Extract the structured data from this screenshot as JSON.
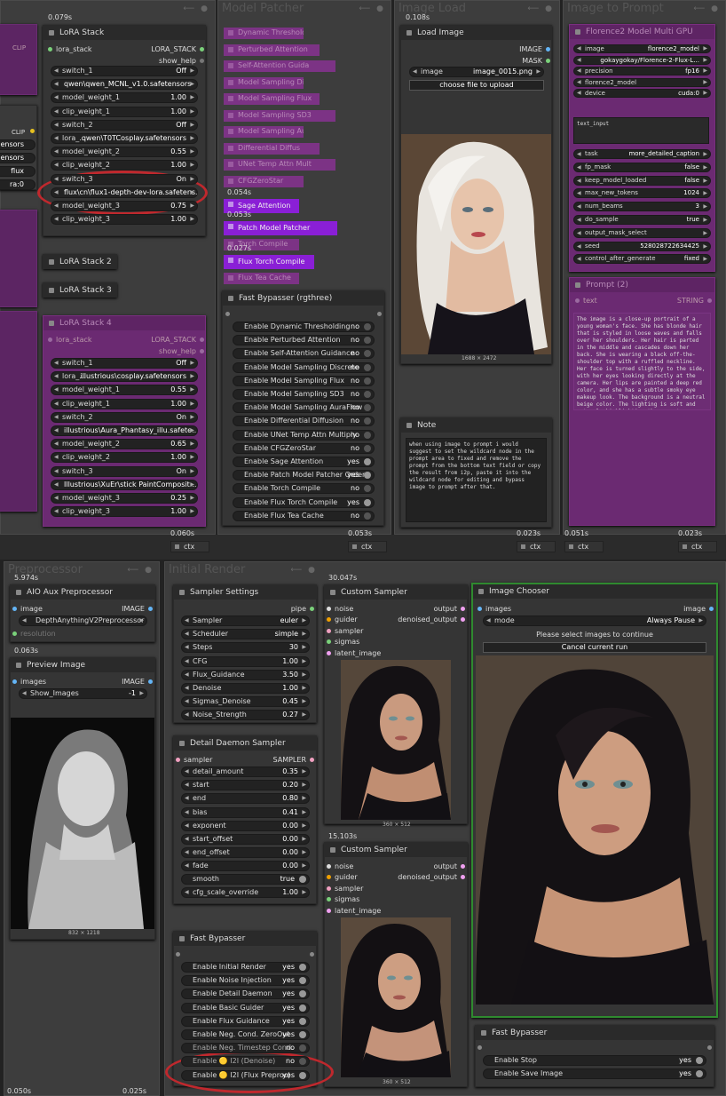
{
  "colors": {
    "purple_node": "#6b2a72",
    "bright_purple": "#8a1fd6",
    "circle": "#c0282d",
    "green_border": "#2f8a2f"
  },
  "lora_stack": {
    "time": "0.079s",
    "title": "LoRA Stack",
    "input": "lora_stack",
    "output": "LORA_STACK",
    "show_help": "show_help",
    "widgets": [
      {
        "label": "switch_1",
        "value": "Off"
      },
      {
        "label": "",
        "value": "qwen\\qwen_MCNL_v1.0.safetensors",
        "center": true
      },
      {
        "label": "model_weight_1",
        "value": "1.00"
      },
      {
        "label": "clip_weight_1",
        "value": "1.00"
      },
      {
        "label": "switch_2",
        "value": "Off"
      },
      {
        "label": "lora_...",
        "value": "qwen\\T0TCosplay.safetensors"
      },
      {
        "label": "model_weight_2",
        "value": "0.55"
      },
      {
        "label": "clip_weight_2",
        "value": "1.00"
      },
      {
        "label": "switch_3",
        "value": "On"
      },
      {
        "label": "",
        "value": "flux\\cn\\flux1-depth-dev-lora.safetens...",
        "center": true
      },
      {
        "label": "model_weight_3",
        "value": "0.75"
      },
      {
        "label": "clip_weight_3",
        "value": "1.00"
      }
    ],
    "lora2": "LoRA Stack 2",
    "lora3": "LoRA Stack 3"
  },
  "left_partial": {
    "clip": "CLIP",
    "sors1": "ensors",
    "sors2": "ensors",
    "flux": "flux",
    "lora": "ra:0"
  },
  "lora4": {
    "title": "LoRA Stack 4",
    "input": "lora_stack",
    "output": "LORA_STACK",
    "show_help": "show_help",
    "widgets": [
      {
        "label": "switch_1",
        "value": "Off"
      },
      {
        "label": "lora_...",
        "value": "illustrious\\cosplay.safetensors"
      },
      {
        "label": "model_weight_1",
        "value": "0.55"
      },
      {
        "label": "clip_weight_1",
        "value": "1.00"
      },
      {
        "label": "switch_2",
        "value": "On"
      },
      {
        "label": "",
        "value": "illustrious\\Aura_Phantasy_illu.safete...",
        "center": true
      },
      {
        "label": "model_weight_2",
        "value": "0.65"
      },
      {
        "label": "clip_weight_2",
        "value": "1.00"
      },
      {
        "label": "switch_3",
        "value": "On"
      },
      {
        "label": "",
        "value": "Illustrious\\XuEr\\stick PaintComposit...",
        "center": true
      },
      {
        "label": "model_weight_3",
        "value": "0.25"
      },
      {
        "label": "clip_weight_3",
        "value": "1.00"
      }
    ]
  },
  "model_patcher": {
    "group": "Model Patcher",
    "nodes": [
      "Dynamic Thresholding",
      "Perturbed Attention",
      "Self-Attention Guida",
      "Model Sampling Discr",
      "Model Sampling Flux",
      "Model Sampling SD3",
      "Model Sampling AuraF",
      "Differential Diffus",
      "UNet Temp Attn Mult",
      "CFGZeroStar"
    ],
    "sage_time": "0.054s",
    "sage": "Sage Attention",
    "patch_time": "0.053s",
    "patch": "Patch Model Patcher",
    "compile": "Torch Compile",
    "flux_time": "0.027s",
    "flux_compile": "Flux Torch Compile",
    "tea": "Flux Tea Cache",
    "fb_title": "Fast Bypasser (rgthree)",
    "fb": [
      {
        "label": "Enable Dynamic Thresholding",
        "value": "no",
        "on": false
      },
      {
        "label": "Enable Perturbed Attention",
        "value": "no",
        "on": false
      },
      {
        "label": "Enable Self-Attention Guidance",
        "value": "no",
        "on": false
      },
      {
        "label": "Enable Model Sampling Discrete",
        "value": "no",
        "on": false
      },
      {
        "label": "Enable Model Sampling Flux",
        "value": "no",
        "on": false
      },
      {
        "label": "Enable Model Sampling SD3",
        "value": "no",
        "on": false
      },
      {
        "label": "Enable Model Sampling AuraFlow",
        "value": "no",
        "on": false
      },
      {
        "label": "Enable Differential Diffusion",
        "value": "no",
        "on": false
      },
      {
        "label": "Enable UNet Temp Attn Multiply",
        "value": "no",
        "on": false
      },
      {
        "label": "Enable CFGZeroStar",
        "value": "no",
        "on": false
      },
      {
        "label": "Enable Sage Attention",
        "value": "yes",
        "on": true
      },
      {
        "label": "Enable Patch Model Patcher Order",
        "value": "yes",
        "on": true
      },
      {
        "label": "Enable Torch Compile",
        "value": "no",
        "on": false
      },
      {
        "label": "Enable Flux Torch Compile",
        "value": "yes",
        "on": true
      },
      {
        "label": "Enable Flux Tea Cache",
        "value": "no",
        "on": false
      }
    ]
  },
  "image_load": {
    "group": "Image Load",
    "time": "0.108s",
    "title": "Load Image",
    "out1": "IMAGE",
    "out2": "MASK",
    "image_label": "image",
    "image_value": "image_0015.png",
    "upload": "choose file to upload",
    "dims": "1688 × 2472",
    "note_title": "Note",
    "note": "when using image to prompt i would suggest to set the wildcard node in the prompt area to fixed and remove the prompt from the bottom text field or copy the result from i2p, paste it into the wildcard node for editing and bypass image to prompt after that."
  },
  "img2prompt": {
    "group": "Image to Prompt",
    "title": "Florence2 Model Multi GPU",
    "rows": [
      {
        "label": "image",
        "value": "florence2_model"
      },
      {
        "label": "",
        "value": "gokaygokay/Florence-2-Flux-L..."
      },
      {
        "label": "precision",
        "value": "fp16"
      },
      {
        "label": "florence2_model",
        "value": ""
      },
      {
        "label": "device",
        "value": "cuda:0"
      }
    ],
    "text_input": "text_input",
    "rows2": [
      {
        "label": "task",
        "value": "more_detailed_caption"
      },
      {
        "label": "fp_mask",
        "value": "false"
      },
      {
        "label": "keep_model_loaded",
        "value": "false"
      },
      {
        "label": "max_new_tokens",
        "value": "1024"
      },
      {
        "label": "num_beams",
        "value": "3"
      },
      {
        "label": "do_sample",
        "value": "true"
      },
      {
        "label": "output_mask_select",
        "value": ""
      },
      {
        "label": "seed",
        "value": "528028722634425"
      },
      {
        "label": "control_after_generate",
        "value": "fixed"
      }
    ],
    "prompt_title": "Prompt (2)",
    "text": "text",
    "string": "STRING",
    "caption": "The image is a close-up portrait of a young woman's face. She has blonde hair that is styled in loose waves and falls over her shoulders. Her hair is parted in the middle and cascades down her back. She is wearing a black off-the-shoulder top with a ruffled neckline. Her face is turned slightly to the side, with her eyes looking directly at the camera. Her lips are painted a deep red color, and she has a subtle smoky eye makeup look. The background is a neutral beige color. The lighting is soft and natural, highlighting the woman's features."
  },
  "ctx_bar": [
    {
      "time": "0.060s",
      "label": "ctx"
    },
    {
      "time": "0.053s",
      "label": "ctx"
    },
    {
      "time": "0.023s",
      "label": "ctx"
    },
    {
      "time": "0.051s",
      "label": "ctx"
    },
    {
      "time": "0.023s",
      "label": "ctx"
    }
  ],
  "preprocessor": {
    "group": "Preprocessor",
    "time": "5.974s",
    "title": "AIO Aux Preprocessor",
    "in": "image",
    "out": "IMAGE",
    "pre": "DepthAnythingV2Preprocessor",
    "res": "resolution",
    "time2": "0.063s",
    "preview_title": "Preview Image",
    "images": "images",
    "show_images": "Show_Images",
    "show_val": "-1",
    "dims": "832 × 1218",
    "bottom": "0.050s"
  },
  "initial_render": {
    "group": "Initial Render",
    "time": "30.047s",
    "sampler_title": "Sampler Settings",
    "pipe": "pipe",
    "sampler": [
      {
        "label": "Sampler",
        "value": "euler"
      },
      {
        "label": "Scheduler",
        "value": "simple"
      },
      {
        "label": "Steps",
        "value": "30"
      },
      {
        "label": "CFG",
        "value": "1.00"
      },
      {
        "label": "Flux_Guidance",
        "value": "3.50"
      },
      {
        "label": "Denoise",
        "value": "1.00"
      },
      {
        "label": "Sigmas_Denoise",
        "value": "0.45"
      },
      {
        "label": "Noise_Strength",
        "value": "0.27"
      }
    ],
    "detail_title": "Detail Daemon Sampler",
    "sampler_in": "sampler",
    "sampler_out": "SAMPLER",
    "detail": [
      {
        "label": "detail_amount",
        "value": "0.35"
      },
      {
        "label": "start",
        "value": "0.20"
      },
      {
        "label": "end",
        "value": "0.80"
      },
      {
        "label": "bias",
        "value": "0.41"
      },
      {
        "label": "exponent",
        "value": "0.00"
      },
      {
        "label": "start_offset",
        "value": "0.00"
      },
      {
        "label": "end_offset",
        "value": "0.00"
      },
      {
        "label": "fade",
        "value": "0.00"
      }
    ],
    "smooth": "smooth",
    "smooth_val": "true",
    "cfg_scale": "cfg_scale_override",
    "cfg_val": "1.00",
    "fb_title": "Fast Bypasser",
    "fb": [
      {
        "label": "Enable Initial Render",
        "value": "yes",
        "on": true
      },
      {
        "label": "Enable Noise Injection",
        "value": "yes",
        "on": true
      },
      {
        "label": "Enable Detail Daemon",
        "value": "yes",
        "on": true
      },
      {
        "label": "Enable Basic Guider",
        "value": "yes",
        "on": true
      },
      {
        "label": "Enable Flux Guidance",
        "value": "yes",
        "on": true
      },
      {
        "label": "Enable Neg. Cond. ZeroOut",
        "value": "yes",
        "on": true
      },
      {
        "label": "Enable Neg. Timestep Cond.",
        "value": "no",
        "on": false
      },
      {
        "label": "Enable 🟡 I2I (Denoise)",
        "value": "no",
        "on": false
      },
      {
        "label": "Enable 🟡 I2I (Flux Preproc)",
        "value": "yes",
        "on": true
      }
    ],
    "cs_title": "Custom Sampler",
    "cs_in": [
      "noise",
      "guider",
      "sampler",
      "sigmas",
      "latent_image"
    ],
    "cs_out": [
      "output",
      "denoised_output"
    ],
    "cs_dims": "360 × 512",
    "cs2_time": "15.103s",
    "bottom": "0.025s"
  },
  "chooser": {
    "title": "Image Chooser",
    "in": "images",
    "out": "image",
    "mode": "mode",
    "mode_val": "Always Pause",
    "msg": "Please select images to continue",
    "cancel": "Cancel current run",
    "fb_title": "Fast Bypasser",
    "fb": [
      {
        "label": "Enable Stop",
        "value": "yes",
        "on": true
      },
      {
        "label": "Enable Save Image",
        "value": "yes",
        "on": true
      }
    ]
  }
}
